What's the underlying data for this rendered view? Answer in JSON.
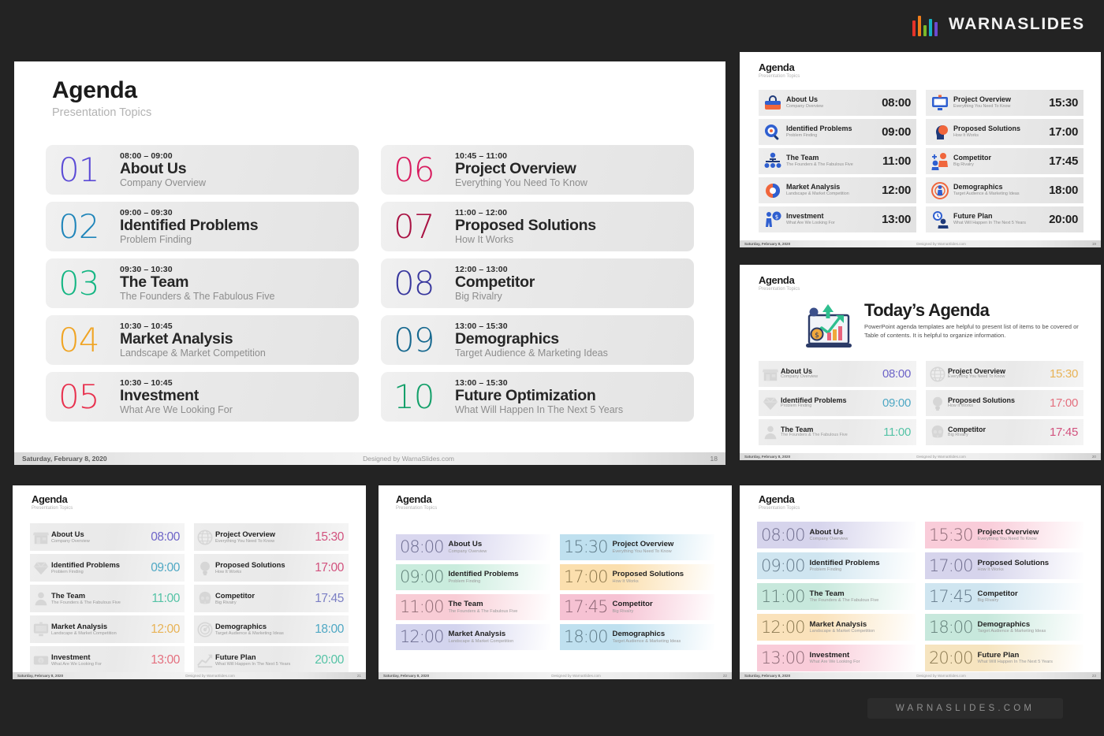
{
  "brand": {
    "name": "WARNASLIDES",
    "bar_colors": [
      "#e5332a",
      "#f07d1b",
      "#7ab829",
      "#15b0c4",
      "#6c4ad0"
    ]
  },
  "watermark": {
    "text": "WARNASLIDES.COM"
  },
  "common": {
    "title": "Agenda",
    "subtitle": "Presentation Topics",
    "footer": {
      "date": "Saturday, February 8, 2020",
      "credit": "Designed by WarnaSlides.com",
      "page": "18"
    }
  },
  "main_slide": {
    "title": "Agenda",
    "subtitle": "Presentation Topics",
    "left_items": [
      {
        "num": "01",
        "time": "08:00 – 09:00",
        "name": "About Us",
        "desc": "Company Overview",
        "color": "#5b4ad6"
      },
      {
        "num": "02",
        "time": "09:00 – 09:30",
        "name": "Identified Problems",
        "desc": "Problem Finding",
        "color": "#1f85ba"
      },
      {
        "num": "03",
        "time": "09:30 – 10:30",
        "name": "The Team",
        "desc": "The Founders & The Fabulous Five",
        "color": "#14b683"
      },
      {
        "num": "04",
        "time": "10:30 – 10:45",
        "name": "Market Analysis",
        "desc": "Landscape & Market Competition",
        "color": "#f0a423"
      },
      {
        "num": "05",
        "time": "10:30 – 10:45",
        "name": "Investment",
        "desc": "What Are We Looking For",
        "color": "#e8314e"
      }
    ],
    "right_items": [
      {
        "num": "06",
        "time": "10:45 – 11:00",
        "name": "Project Overview",
        "desc": "Everything You Need To Know",
        "color": "#d81b5e"
      },
      {
        "num": "07",
        "time": "11:00 – 12:00",
        "name": "Proposed Solutions",
        "desc": "How It Works",
        "color": "#a91243"
      },
      {
        "num": "08",
        "time": "12:00 – 13:00",
        "name": "Competitor",
        "desc": "Big Rivalry",
        "color": "#38379e"
      },
      {
        "num": "09",
        "time": "13:00 – 15:30",
        "name": "Demographics",
        "desc": "Target Audience & Marketing Ideas",
        "color": "#16688f"
      },
      {
        "num": "10",
        "time": "13:00 – 15:30",
        "name": "Future Optimization",
        "desc": "What Will Happen In The Next 5 Years",
        "color": "#14a06a"
      }
    ],
    "footer": {
      "date": "Saturday, February 8, 2020",
      "credit": "Designed by WarnaSlides.com",
      "page": "18"
    }
  },
  "slide_icon_time": {
    "title": "Agenda",
    "subtitle": "Presentation Topics",
    "left_items": [
      {
        "icon": "briefcase-icon",
        "name": "About Us",
        "desc": "Company Overview",
        "time": "08:00"
      },
      {
        "icon": "magnifier-target-icon",
        "name": "Identified Problems",
        "desc": "Problem Finding",
        "time": "09:00"
      },
      {
        "icon": "org-chart-icon",
        "name": "The Team",
        "desc": "The Founders & The Fabulous Five",
        "time": "11:00"
      },
      {
        "icon": "donut-chart-icon",
        "name": "Market Analysis",
        "desc": "Landscape & Market Competition",
        "time": "12:00"
      },
      {
        "icon": "person-money-icon",
        "name": "Investment",
        "desc": "What Are We Looking For",
        "time": "13:00"
      }
    ],
    "right_items": [
      {
        "icon": "monitor-icon",
        "name": "Project Overview",
        "desc": "Everything You Need To Know",
        "time": "15:30"
      },
      {
        "icon": "head-idea-icon",
        "name": "Proposed Solutions",
        "desc": "How It Works",
        "time": "17:00"
      },
      {
        "icon": "two-people-icon",
        "name": "Competitor",
        "desc": "Big Rivalry",
        "time": "17:45"
      },
      {
        "icon": "target-person-icon",
        "name": "Demographics",
        "desc": "Target Audience & Marketing Ideas",
        "time": "18:00"
      },
      {
        "icon": "clock-people-icon",
        "name": "Future Plan",
        "desc": "What Will Happen In The Next 5 Years",
        "time": "20:00"
      }
    ],
    "footer": {
      "date": "Saturday, February 8, 2020",
      "credit": "Designed by WarnaSlides.com",
      "page": "19"
    }
  },
  "slide_todays_agenda": {
    "title": "Agenda",
    "subtitle": "Presentation Topics",
    "hero_heading": "Today’s Agenda",
    "hero_paragraph": "PowerPoint agenda templates are helpful to present list of items to be covered or Table of contents. It is helpful to organize information.",
    "hero_icon": "growth-chart-icon",
    "left_items": [
      {
        "icon": "store-icon",
        "name": "About Us",
        "desc": "Company Overview",
        "time": "08:00",
        "time_color": "#6e65c8"
      },
      {
        "icon": "diamond-icon",
        "name": "Identified Problems",
        "desc": "Problem Finding",
        "time": "09:00",
        "time_color": "#4fa8c4"
      },
      {
        "icon": "person-icon",
        "name": "The Team",
        "desc": "The Founders & The Fabulous Five",
        "time": "11:00",
        "time_color": "#55c3a6"
      }
    ],
    "right_items": [
      {
        "icon": "globe-icon",
        "name": "Project Overview",
        "desc": "Everything You Need To Know",
        "time": "15:30",
        "time_color": "#e8b356"
      },
      {
        "icon": "lightbulb-icon",
        "name": "Proposed Solutions",
        "desc": "How It Works",
        "time": "17:00",
        "time_color": "#e4707f"
      },
      {
        "icon": "skull-icon",
        "name": "Competitor",
        "desc": "Big Rivalry",
        "time": "17:45",
        "time_color": "#d2527e"
      }
    ],
    "footer": {
      "date": "Saturday, February 8, 2020",
      "credit": "Designed by WarnaSlides.com",
      "page": "20"
    }
  },
  "slide_icon_color_time": {
    "title": "Agenda",
    "subtitle": "Presentation Topics",
    "left_items": [
      {
        "icon": "store-icon",
        "name": "About Us",
        "desc": "Company Overview",
        "time": "08:00",
        "time_color": "#6e65c8"
      },
      {
        "icon": "diamond-icon",
        "name": "Identified Problems",
        "desc": "Problem Finding",
        "time": "09:00",
        "time_color": "#4fa8c4"
      },
      {
        "icon": "person-icon",
        "name": "The Team",
        "desc": "The Founders & The Fabulous Five",
        "time": "11:00",
        "time_color": "#55c3a6"
      },
      {
        "icon": "monitor-icon",
        "name": "Market Analysis",
        "desc": "Landscape & Market Competition",
        "time": "12:00",
        "time_color": "#e8b356"
      },
      {
        "icon": "money-icon",
        "name": "Investment",
        "desc": "What Are We Looking For",
        "time": "13:00",
        "time_color": "#e4707f"
      }
    ],
    "right_items": [
      {
        "icon": "globe-icon",
        "name": "Project Overview",
        "desc": "Everything You Need To Know",
        "time": "15:30",
        "time_color": "#d2527e"
      },
      {
        "icon": "lightbulb-icon",
        "name": "Proposed Solutions",
        "desc": "How It Works",
        "time": "17:00",
        "time_color": "#d2527e"
      },
      {
        "icon": "skull-icon",
        "name": "Competitor",
        "desc": "Big Rivalry",
        "time": "17:45",
        "time_color": "#7b7fc4"
      },
      {
        "icon": "target-icon",
        "name": "Demographics",
        "desc": "Target Audience & Marketing Ideas",
        "time": "18:00",
        "time_color": "#4fa8c4"
      },
      {
        "icon": "growth-arrow-icon",
        "name": "Future Plan",
        "desc": "What Will Happen In The Next 5 Years",
        "time": "20:00",
        "time_color": "#55c3a6"
      }
    ],
    "footer": {
      "date": "Saturday, February 8, 2020",
      "credit": "Designed by WarnaSlides.com",
      "page": "21"
    }
  },
  "slide_time_blocks_4": {
    "title": "Agenda",
    "subtitle": "Presentation Topics",
    "left_items": [
      {
        "time": "08:00",
        "name": "About Us",
        "desc": "Company Overview",
        "bg": "#d9d7ef",
        "time_color": "#6b6b8f"
      },
      {
        "time": "09:00",
        "name": "Identified Problems",
        "desc": "Problem Finding",
        "bg": "#c9ecdd",
        "time_color": "#5e7e76"
      },
      {
        "time": "11:00",
        "name": "The Team",
        "desc": "The Founders & The Fabulous Five",
        "bg": "#f8ccd5",
        "time_color": "#8e6b74"
      },
      {
        "time": "12:00",
        "name": "Market Analysis",
        "desc": "Landscape & Market Competition",
        "bg": "#d3d4ee",
        "time_color": "#6b6b8f"
      }
    ],
    "right_items": [
      {
        "time": "15:30",
        "name": "Project Overview",
        "desc": "Everything You Need To Know",
        "bg": "#bfe0ef",
        "time_color": "#5e7a87"
      },
      {
        "time": "17:00",
        "name": "Proposed Solutions",
        "desc": "How It Works",
        "bg": "#fbdfae",
        "time_color": "#8a7549"
      },
      {
        "time": "17:45",
        "name": "Competitor",
        "desc": "Big Rivalry",
        "bg": "#f6c2d3",
        "time_color": "#8c6574"
      },
      {
        "time": "18:00",
        "name": "Demographics",
        "desc": "Target Audience & Marketing Ideas",
        "bg": "#bfe0ef",
        "time_color": "#5e7a87"
      }
    ],
    "footer": {
      "date": "Saturday, February 8, 2020",
      "credit": "Designed by WarnaSlides.com",
      "page": "22"
    }
  },
  "slide_time_blocks_5": {
    "title": "Agenda",
    "subtitle": "Presentation Topics",
    "left_items": [
      {
        "time": "08:00",
        "name": "About Us",
        "desc": "Company Overview",
        "bg": "#d6d4ec",
        "time_color": "#6f6d8e"
      },
      {
        "time": "09:00",
        "name": "Identified Problems",
        "desc": "Problem Finding",
        "bg": "#cfe5f0",
        "time_color": "#63798a"
      },
      {
        "time": "11:00",
        "name": "The Team",
        "desc": "The Founders & The Fabulous Five",
        "bg": "#c7e8dc",
        "time_color": "#637f79"
      },
      {
        "time": "12:00",
        "name": "Market Analysis",
        "desc": "Landscape & Market Competition",
        "bg": "#fae2bb",
        "time_color": "#8a7850"
      },
      {
        "time": "13:00",
        "name": "Investment",
        "desc": "What Are We Looking For",
        "bg": "#f9ccd9",
        "time_color": "#8d6a76"
      }
    ],
    "right_items": [
      {
        "time": "15:30",
        "name": "Project Overview",
        "desc": "Everything You Need To Know",
        "bg": "#f9ccd9",
        "time_color": "#8d6a76"
      },
      {
        "time": "17:00",
        "name": "Proposed Solutions",
        "desc": "How It Works",
        "bg": "#d6d4ec",
        "time_color": "#6f6d8e"
      },
      {
        "time": "17:45",
        "name": "Competitor",
        "desc": "Big Rivalry",
        "bg": "#cfe5f0",
        "time_color": "#63798a"
      },
      {
        "time": "18:00",
        "name": "Demographics",
        "desc": "Target Audience & Marketing Ideas",
        "bg": "#c7e8dc",
        "time_color": "#637f79"
      },
      {
        "time": "20:00",
        "name": "Future Plan",
        "desc": "What Will Happen In The Next 5 Years",
        "bg": "#f6e4bf",
        "time_color": "#8a7850"
      }
    ],
    "footer": {
      "date": "Saturday, February 8, 2020",
      "credit": "Designed by WarnaSlides.com",
      "page": "23"
    }
  }
}
